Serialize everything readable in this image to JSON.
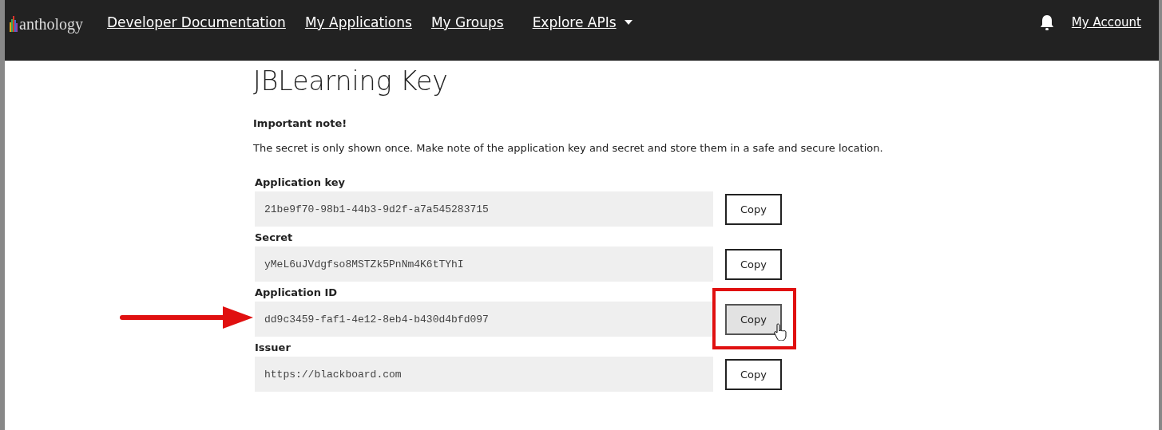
{
  "header": {
    "logo": "anthology",
    "nav": [
      {
        "label": "Developer Documentation",
        "dropdown": false
      },
      {
        "label": "My Applications",
        "dropdown": false
      },
      {
        "label": "My Groups",
        "dropdown": false
      },
      {
        "label": "Explore APIs",
        "dropdown": true
      }
    ],
    "account": "My Account"
  },
  "title": "JBLearning Key",
  "note": {
    "heading": "Important note!",
    "text": "The secret is only shown once. Make note of the application key and secret and store them in a safe and secure location."
  },
  "fields": [
    {
      "label": "Application key",
      "value": "21be9f70-98b1-44b3-9d2f-a7a545283715",
      "button": "Copy",
      "highlighted": false
    },
    {
      "label": "Secret",
      "value": "yMeL6uJVdgfso8MSTZk5PnNm4K6tTYhI",
      "button": "Copy",
      "highlighted": false
    },
    {
      "label": "Application ID",
      "value": "dd9c3459-faf1-4e12-8eb4-b430d4bfd097",
      "button": "Copy",
      "highlighted": true
    },
    {
      "label": "Issuer",
      "value": "https://blackboard.com",
      "button": "Copy",
      "highlighted": false
    }
  ]
}
